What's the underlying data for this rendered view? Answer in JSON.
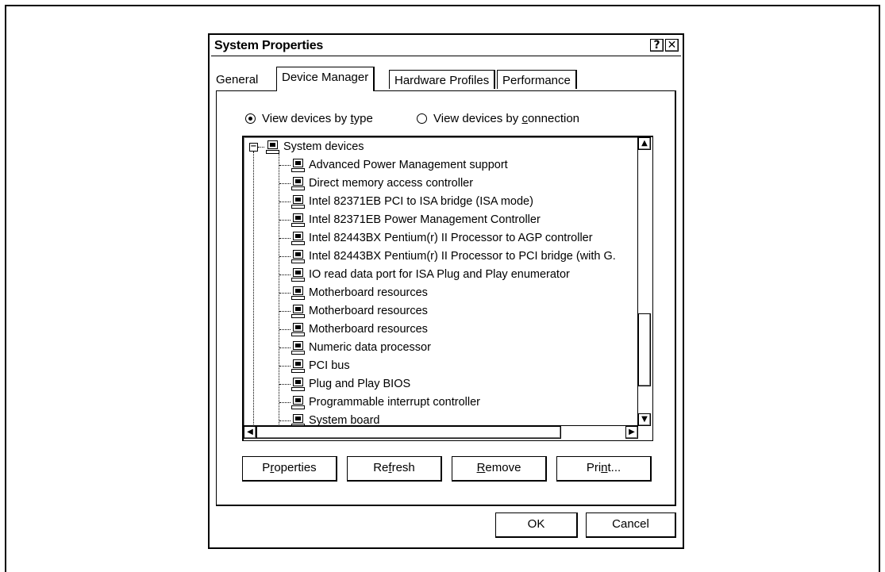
{
  "window": {
    "title": "System Properties",
    "help_glyph": "?",
    "close_glyph": "✕"
  },
  "tabs": [
    {
      "label": "General"
    },
    {
      "label": "Device Manager"
    },
    {
      "label": "Hardware Profiles"
    },
    {
      "label": "Performance"
    }
  ],
  "view_options": {
    "by_type": {
      "pre": "View devices by ",
      "key": "t",
      "post": "ype",
      "selected": true
    },
    "by_connection": {
      "pre": "View devices by ",
      "key": "c",
      "post": "onnection",
      "selected": false
    }
  },
  "tree": {
    "expander_glyph": "−",
    "root": {
      "label": "System devices"
    },
    "children": [
      "Advanced Power Management support",
      "Direct memory access controller",
      "Intel 82371EB PCI to ISA bridge (ISA mode)",
      "Intel 82371EB Power Management Controller",
      "Intel 82443BX Pentium(r) II Processor to AGP controller",
      "Intel 82443BX Pentium(r) II Processor to PCI bridge (with G.",
      "IO read data port for ISA Plug and Play enumerator",
      "Motherboard resources",
      "Motherboard resources",
      "Motherboard resources",
      "Numeric data processor",
      "PCI bus",
      "Plug and Play BIOS",
      "Programmable interrupt controller",
      "System board"
    ]
  },
  "scrollbar_glyphs": {
    "up": "▲",
    "down": "▼",
    "left": "◀",
    "right": "▶"
  },
  "buttons": {
    "properties": {
      "pre": "P",
      "key": "r",
      "post": "operties"
    },
    "refresh": {
      "pre": "Re",
      "key": "f",
      "post": "resh"
    },
    "remove": {
      "pre": "",
      "key": "R",
      "post": "emove"
    },
    "print": {
      "pre": "Pri",
      "key": "n",
      "post": "t..."
    },
    "ok": "OK",
    "cancel": "Cancel"
  }
}
